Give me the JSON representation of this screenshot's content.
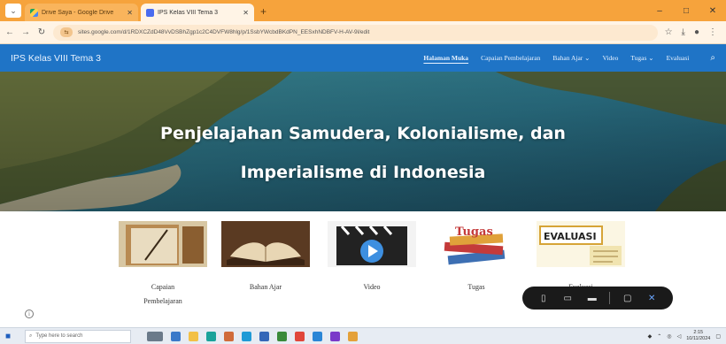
{
  "browser": {
    "tabs": [
      {
        "title": "Drive Saya - Google Drive",
        "active": false
      },
      {
        "title": "IPS Kelas VIII Tema 3",
        "active": true
      }
    ],
    "new_tab": "+",
    "url": "sites.google.com/d/1RDXCZdD48VvDSBhZgp1c2C4DVFW8hlg/p/1SsbYWcbdBKdPN_EESxhNDBFV-H-AV-9l/edit",
    "window_controls": [
      "–",
      "□",
      "✕"
    ]
  },
  "site": {
    "title": "IPS Kelas VIII Tema 3",
    "nav": [
      "Halaman Muka",
      "Capaian Pembelajaran",
      "Bahan Ajar ⌄",
      "Video",
      "Tugas ⌄",
      "Evaluasi"
    ]
  },
  "hero": {
    "line1": "Penjelajahan Samudera, Kolonialisme, dan",
    "line2": "Imperialisme di Indonesia"
  },
  "cards": [
    {
      "label_1": "Capaian",
      "label_2": "Pembelajaran"
    },
    {
      "label_1": "Bahan Ajar",
      "label_2": ""
    },
    {
      "label_1": "Video",
      "label_2": ""
    },
    {
      "label_1": "Tugas",
      "label_2": ""
    },
    {
      "label_1": "Evaluasi",
      "label_2": ""
    }
  ],
  "card_images": {
    "tugas_text": "Tugas",
    "evaluasi_text": "EVALUASI"
  },
  "taskbar": {
    "search_placeholder": "Type here to search",
    "clock_time": "2:15",
    "clock_date": "10/11/2024"
  },
  "colors": {
    "tab_strip": "#f6a33c",
    "site_nav": "#1f74c6"
  }
}
